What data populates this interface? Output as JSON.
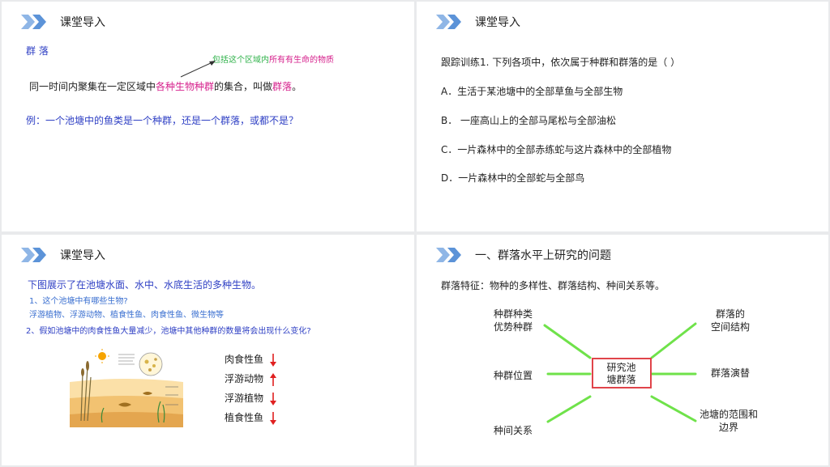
{
  "colors": {
    "accent_chevron": "#8fb6e6",
    "blue_text": "#2e3fc4",
    "magenta": "#d6208c",
    "green": "#2fb24a",
    "mindmap_line": "#6fe24a",
    "center_border": "#e0444a"
  },
  "slide1": {
    "header": "课堂导入",
    "term": "群 落",
    "annotation": {
      "part1": "包括这个区域内",
      "part2": "所有有生命的物质"
    },
    "definition": {
      "part1": "同一时间内聚集在一定区域中",
      "part2": "各种生物种群",
      "part3": "的集合，叫做",
      "part4": "群落",
      "part5": "。"
    },
    "example": "例：一个池塘中的鱼类是一个种群，还是一个群落，或都不是？"
  },
  "slide2": {
    "header": "课堂导入",
    "question": "跟踪训练1. 下列各项中，依次属于种群和群落的是（    ）",
    "options": [
      "A．生活于某池塘中的全部草鱼与全部生物",
      "B．  一座高山上的全部马尾松与全部油松",
      "C．一片森林中的全部赤练蛇与这片森林中的全部植物",
      "D．一片森林中的全部蛇与全部鸟"
    ]
  },
  "slide3": {
    "header": "课堂导入",
    "intro": "下图展示了在池塘水面、水中、水底生活的多种生物。",
    "q1": "1、这个池塘中有哪些生物?",
    "a1": "浮游植物、浮游动物、植食性鱼、肉食性鱼、微生物等",
    "q2": "2、假如池塘中的肉食性鱼大量减少，池塘中其他种群的数量将会出现什么变化?",
    "changes": [
      {
        "label": "肉食性鱼",
        "direction": "down"
      },
      {
        "label": "浮游动物",
        "direction": "up"
      },
      {
        "label": "浮游植物",
        "direction": "down"
      },
      {
        "label": "植食性鱼",
        "direction": "down"
      }
    ]
  },
  "slide4": {
    "header": "一、群落水平上研究的问题",
    "features": "群落特征：物种的多样性、群落结构、种间关系等。",
    "center": {
      "line1": "研究池",
      "line2": "塘群落"
    },
    "nodes": {
      "top_left": {
        "line1": "种群种类",
        "line2": "优势种群"
      },
      "mid_left": {
        "line1": "种群位置"
      },
      "bottom_left": {
        "line1": "种间关系"
      },
      "top_right": {
        "line1": "群落的",
        "line2": "空间结构"
      },
      "mid_right": {
        "line1": "群落演替"
      },
      "bottom_right": {
        "line1": "池塘的范围和",
        "line2": "边界"
      }
    }
  }
}
